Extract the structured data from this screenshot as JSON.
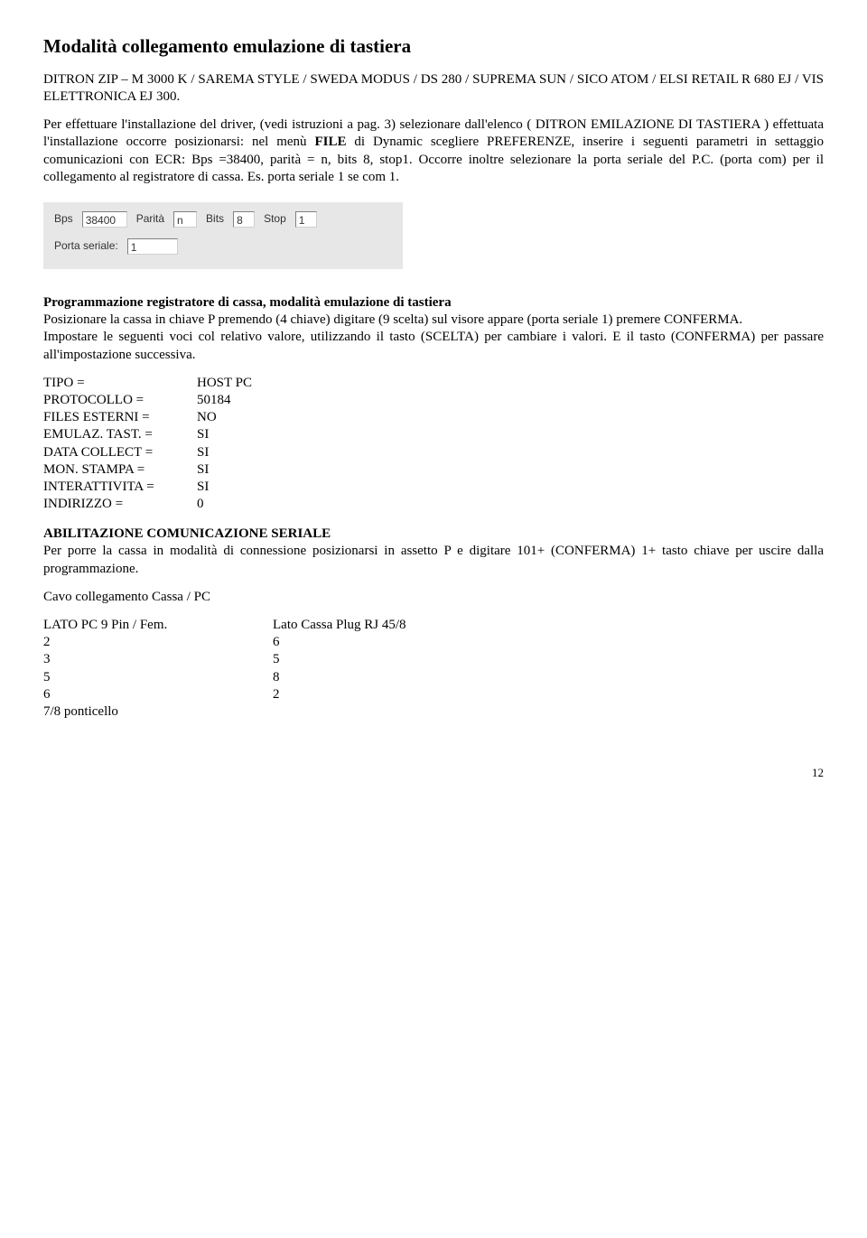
{
  "title": "Modalità collegamento emulazione di tastiera",
  "models_line": "DITRON ZIP – M 3000 K / SAREMA STYLE / SWEDA MODUS / DS 280 / SUPREMA SUN / SICO ATOM / ELSI RETAIL R 680 EJ / VIS ELETTRONICA EJ 300.",
  "intro_pre": "Per effettuare l'installazione del driver, (vedi istruzioni a pag. 3) selezionare dall'elenco ( DITRON EMILAZIONE DI TASTIERA ) effettuata l'installazione occorre posizionarsi: nel menù ",
  "intro_bold": "FILE",
  "intro_post": " di Dynamic scegliere PREFERENZE, inserire i seguenti parametri in settaggio comunicazioni con ECR: Bps =38400, parità = n, bits 8, stop1. Occorre inoltre selezionare la porta seriale del P.C. (porta com) per il collegamento al registratore di cassa. Es. porta seriale 1 se com 1.",
  "config": {
    "bps_label": "Bps",
    "bps_value": "38400",
    "parita_label": "Parità",
    "parita_value": "n",
    "bits_label": "Bits",
    "bits_value": "8",
    "stop_label": "Stop",
    "stop_value": "1",
    "porta_label": "Porta seriale:",
    "porta_value": "1"
  },
  "prog_title": "Programmazione registratore di cassa, modalità emulazione di tastiera",
  "prog_line1": "Posizionare la cassa in chiave P premendo (4 chiave) digitare (9 scelta) sul visore appare (porta seriale 1) premere CONFERMA.",
  "prog_line2": "Impostare le seguenti voci col relativo valore, utilizzando il tasto (SCELTA) per cambiare i valori. E il tasto (CONFERMA) per passare all'impostazione successiva.",
  "kv": [
    {
      "key": "TIPO =",
      "val": "HOST PC"
    },
    {
      "key": "PROTOCOLLO =",
      "val": "50184"
    },
    {
      "key": "FILES ESTERNI =",
      "val": "NO"
    },
    {
      "key": "EMULAZ. TAST. =",
      "val": "SI"
    },
    {
      "key": "DATA COLLECT =",
      "val": "SI"
    },
    {
      "key": "MON. STAMPA =",
      "val": "SI"
    },
    {
      "key": "INTERATTIVITA =",
      "val": "SI"
    },
    {
      "key": "INDIRIZZO =",
      "val": "0"
    }
  ],
  "abil_title": "ABILITAZIONE COMUNICAZIONE SERIALE",
  "abil_text": "Per porre la cassa in modalità di connessione posizionarsi in assetto P e digitare 101+ (CONFERMA) 1+ tasto chiave per uscire dalla programmazione.",
  "cavo_title": "Cavo collegamento Cassa / PC",
  "cable_head_a": "LATO PC 9 Pin / Fem.",
  "cable_head_b": "Lato Cassa Plug RJ 45/8",
  "cable_rows": [
    {
      "a": "2",
      "b": "6"
    },
    {
      "a": "3",
      "b": "5"
    },
    {
      "a": "5",
      "b": "8"
    },
    {
      "a": "6",
      "b": "2"
    }
  ],
  "cable_foot": "7/8 ponticello",
  "page_number": "12"
}
